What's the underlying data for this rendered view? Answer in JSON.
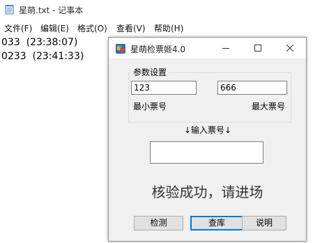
{
  "notepad": {
    "title": "星萌.txt - 记事本",
    "menu": [
      "文件(F)",
      "编辑(E)",
      "格式(O)",
      "查看(V)",
      "帮助(H)"
    ],
    "lines": [
      "033  (23:38:07)",
      "0233  (23:41:33)"
    ]
  },
  "dialog": {
    "title": "星萌检票姬4.0",
    "group_title": "参数设置",
    "min_value": "123",
    "max_value": "666",
    "min_label": "最小票号",
    "max_label": "最大票号",
    "input_label": "↓输入票号↓",
    "ticket_value": "",
    "result_text": "核验成功，请进场",
    "buttons": {
      "check": "检测",
      "query": "查库",
      "help": "说明"
    }
  }
}
